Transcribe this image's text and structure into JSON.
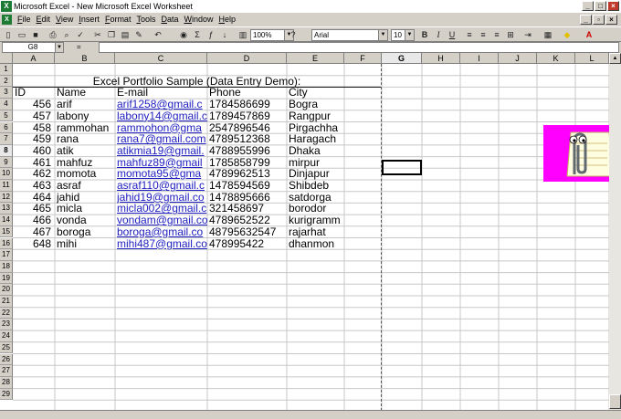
{
  "window": {
    "title": "Microsoft Excel - New Microsoft Excel Worksheet"
  },
  "menu": [
    "File",
    "Edit",
    "View",
    "Insert",
    "Format",
    "Tools",
    "Data",
    "Window",
    "Help"
  ],
  "toolbar": {
    "zoom": "100%",
    "font": "Arial",
    "font_size": "10",
    "bold": "B",
    "italic": "I",
    "underline": "U"
  },
  "formula_bar": {
    "name_box": "G8",
    "fx": "="
  },
  "columns": [
    "A",
    "B",
    "C",
    "D",
    "E",
    "F",
    "G",
    "H",
    "I",
    "J",
    "K",
    "L"
  ],
  "rows": [
    "1",
    "2",
    "3",
    "4",
    "5",
    "6",
    "7",
    "8",
    "9",
    "10",
    "11",
    "12",
    "13",
    "14",
    "15",
    "16",
    "17",
    "18",
    "19",
    "20",
    "21",
    "22",
    "23",
    "24",
    "25",
    "26",
    "27",
    "28",
    "29"
  ],
  "sheet": {
    "title": "Excel Portfolio Sample (Data Entry Demo):",
    "headers": [
      "ID",
      "Name",
      "E-mail",
      "Phone",
      "City"
    ],
    "records": [
      [
        "456",
        "arif",
        "arif1258@gmail.c",
        "1784586699",
        "Bogra"
      ],
      [
        "457",
        "labony",
        "labony14@gmail.c",
        "1789457869",
        "Rangpur"
      ],
      [
        "458",
        "rammohan",
        "rammohon@gma",
        "2547896546",
        "Pirgachha"
      ],
      [
        "459",
        "rana",
        "rana7@gmail.com",
        "4789512368",
        "Haragach"
      ],
      [
        "460",
        "atik",
        "atikmia19@gmail.",
        "4788955996",
        "Dhaka"
      ],
      [
        "461",
        "mahfuz",
        "mahfuz89@gmail",
        "1785858799",
        "mirpur"
      ],
      [
        "462",
        "momota",
        "momota95@gma",
        "4789962513",
        "Dinjapur"
      ],
      [
        "463",
        "asraf",
        "asraf110@gmail.c",
        "1478594569",
        "Shibdeb"
      ],
      [
        "464",
        "jahid",
        "jahid19@gmail.co",
        "1478895666",
        "satdorga"
      ],
      [
        "465",
        "micla",
        "micla002@gmail.c",
        "321458697",
        "borodor"
      ],
      [
        "466",
        "vonda",
        "vondam@gmail.co",
        "4789652522",
        "kurigramm"
      ],
      [
        "467",
        "boroga",
        "boroga@gmail.co",
        "48795632547",
        "rajarhat"
      ],
      [
        "648",
        "mihi",
        "mihi487@gmail.co",
        "478995422",
        "dhanmon"
      ]
    ]
  }
}
